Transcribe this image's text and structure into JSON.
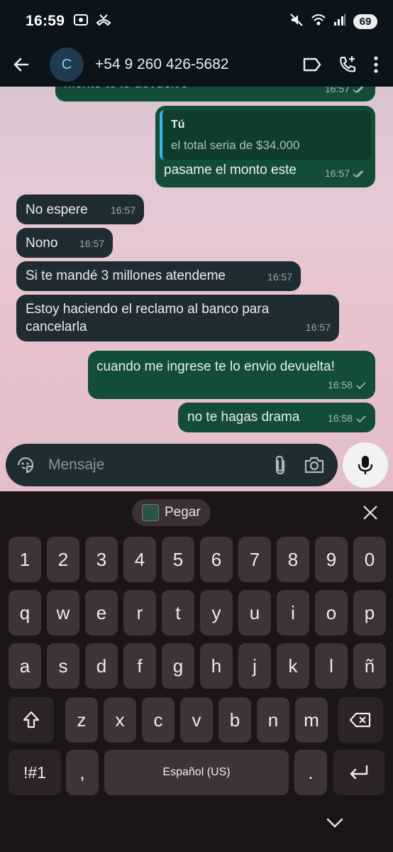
{
  "status_bar": {
    "time": "16:59",
    "battery": "69",
    "icons": [
      "screenshot-icon",
      "missed-call-icon",
      "mute-icon",
      "wifi-icon",
      "signal-icon"
    ]
  },
  "app_bar": {
    "avatar_letter": "C",
    "contact": "+54 9 260 426-5682",
    "icons": [
      "back-arrow-icon",
      "label-icon",
      "add-call-icon",
      "more-vert-icon"
    ]
  },
  "chat": {
    "messages": [
      {
        "dir": "out",
        "text": "monto te lo devuelvo",
        "time": "16:57",
        "status": "read"
      },
      {
        "dir": "out",
        "quote_author": "Tú",
        "quote_text": "el total seria de $34.000",
        "text": "pasame el monto este",
        "time": "16:57",
        "status": "read"
      },
      {
        "dir": "in",
        "text": "No espere",
        "time": "16:57"
      },
      {
        "dir": "in",
        "text": "Nono",
        "time": "16:57"
      },
      {
        "dir": "in",
        "text": "Si te mandé 3 millones atendeme",
        "time": "16:57"
      },
      {
        "dir": "in",
        "text": "Estoy haciendo el reclamo al banco para cancelarla",
        "time": "16:57"
      },
      {
        "dir": "out",
        "text": "cuando me ingrese te lo envio devuelta!",
        "time": "16:58",
        "status": "sent"
      },
      {
        "dir": "out",
        "text": "no te hagas drama",
        "time": "16:58",
        "status": "sent"
      }
    ]
  },
  "composer": {
    "placeholder": "Mensaje",
    "icons": [
      "sticker-icon",
      "attach-icon",
      "camera-icon",
      "mic-icon"
    ]
  },
  "keyboard": {
    "paste_label": "Pegar",
    "row1": [
      "1",
      "2",
      "3",
      "4",
      "5",
      "6",
      "7",
      "8",
      "9",
      "0"
    ],
    "row2": [
      "q",
      "w",
      "e",
      "r",
      "t",
      "y",
      "u",
      "i",
      "o",
      "p"
    ],
    "row3": [
      "a",
      "s",
      "d",
      "f",
      "g",
      "h",
      "j",
      "k",
      "l",
      "ñ"
    ],
    "row4": [
      "z",
      "x",
      "c",
      "v",
      "b",
      "n",
      "m"
    ],
    "symbols_label": "!#1",
    "comma_label": ",",
    "space_label": "Español (US)",
    "period_label": ".",
    "colors": {
      "key": "#3e3337",
      "background": "#1c1518"
    }
  },
  "colors": {
    "outgoing_bubble": "#144d37",
    "incoming_bubble": "#202c33",
    "chat_background": "#e3c6d2",
    "read_check": "#a3b9ae"
  }
}
